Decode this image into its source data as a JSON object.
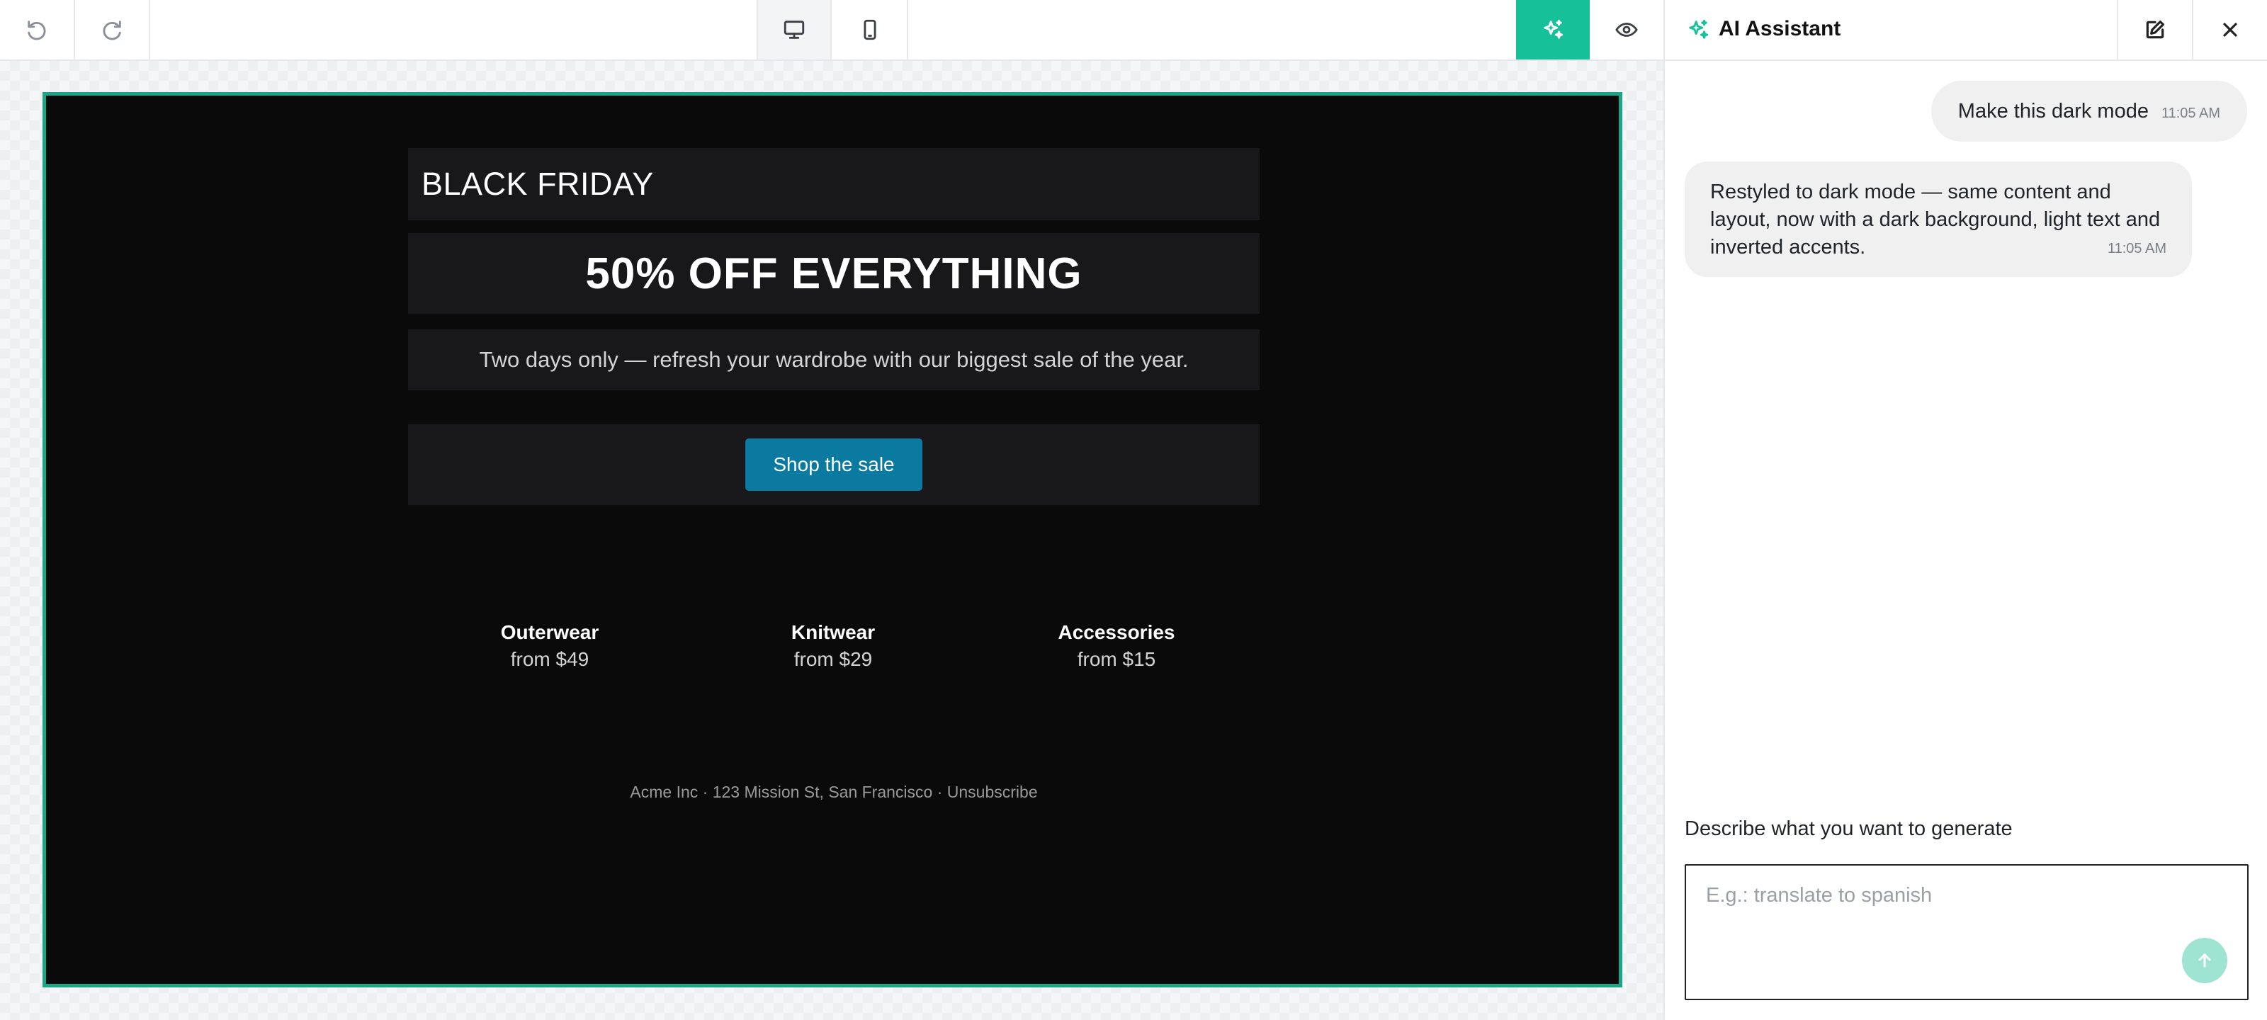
{
  "toolbar": {
    "undo_icon": "undo-icon",
    "redo_icon": "redo-icon",
    "desktop_icon": "desktop-icon",
    "mobile_icon": "mobile-icon",
    "ai_icon": "sparkles-icon",
    "preview_icon": "eye-icon",
    "accent_color": "#16c19a"
  },
  "email": {
    "title": "BLACK FRIDAY",
    "headline": "50% OFF EVERYTHING",
    "subtitle": "Two days only — refresh your wardrobe with our biggest sale of the year.",
    "cta_label": "Shop the sale",
    "cta_color": "#0a7aa1",
    "categories": [
      {
        "name": "Outerwear",
        "price": "from $49"
      },
      {
        "name": "Knitwear",
        "price": "from $29"
      },
      {
        "name": "Accessories",
        "price": "from $15"
      }
    ],
    "footer": "Acme Inc · 123 Mission St, San Francisco · Unsubscribe",
    "background_color": "#0a0a0a",
    "frame_color": "#19a586"
  },
  "panel": {
    "title": "AI Assistant",
    "title_icon": "sparkles-icon",
    "new_chat_icon": "edit-icon",
    "close_icon": "close-icon",
    "messages": [
      {
        "role": "user",
        "text": "Make this dark mode",
        "time": "11:05 AM"
      },
      {
        "role": "assistant",
        "text": "Restyled to dark mode — same content and layout, now with a dark background, light text and inverted accents.",
        "time": "11:05 AM"
      }
    ],
    "prompt_label": "Describe what you want to generate",
    "prompt_value": "",
    "prompt_placeholder": "E.g.: translate to spanish",
    "send_icon": "arrow-up-icon"
  }
}
